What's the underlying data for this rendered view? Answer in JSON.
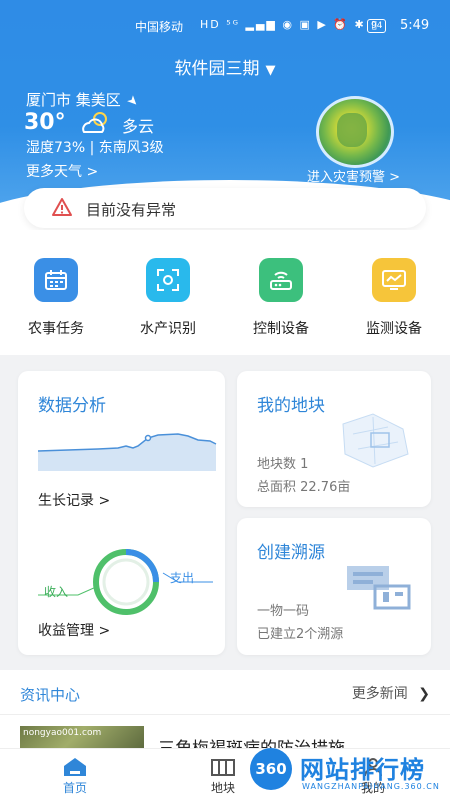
{
  "status_bar": {
    "carrier": "中国移动",
    "icons": "HD ⁵ᴳ ▂▄▆ ◉ ▣ ▶ ⏰ ✱ ▯",
    "battery": "94",
    "time": "5:49"
  },
  "farm": {
    "name": "软件园三期"
  },
  "weather": {
    "location": "厦门市 集美区",
    "temperature": "30°",
    "condition": "多云",
    "humidity_wind": "湿度73% | 东南风3级",
    "more": "更多天气 >",
    "disaster": "进入灾害预警 >"
  },
  "alert": {
    "text": "目前没有异常"
  },
  "quick_menu": [
    {
      "label": "农事任务",
      "icon": "calendar-icon",
      "color": "#3a8fe6"
    },
    {
      "label": "水产识别",
      "icon": "scan-icon",
      "color": "#29b9ec"
    },
    {
      "label": "控制设备",
      "icon": "router-icon",
      "color": "#3cc07d"
    },
    {
      "label": "监测设备",
      "icon": "monitor-icon",
      "color": "#f6c53a"
    }
  ],
  "cards": {
    "analysis": {
      "title": "数据分析",
      "growth": "生长记录 >",
      "income": "收入",
      "expense": "支出",
      "profit": "收益管理 >"
    },
    "plots": {
      "title": "我的地块",
      "count": "地块数 1",
      "area": "总面积 22.76亩"
    },
    "trace": {
      "title": "创建溯源",
      "desc": "一物一码",
      "count": "已建立2个溯源"
    }
  },
  "news": {
    "title": "资讯中心",
    "more": "更多新闻",
    "thumb_text": "nongyao001.com",
    "headline": "三角梅褐斑病的防治措施"
  },
  "tabs": [
    {
      "label": "首页",
      "active": true
    },
    {
      "label": "地块",
      "active": false
    },
    {
      "label": "我的",
      "active": false
    }
  ],
  "watermark": {
    "logo": "360",
    "title": "网站排行榜",
    "url": "WANGZHANPAIHANG.360.CN"
  },
  "colors": {
    "primary": "#2f86d8",
    "header": "#2f8ce6"
  }
}
